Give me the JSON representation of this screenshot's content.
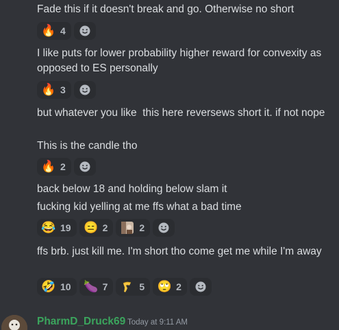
{
  "messages": [
    {
      "text": "Fade this if it doesn't break and go. Otherwise no short",
      "reactions": [
        {
          "emoji": "🔥",
          "emoji_name": "fire",
          "count": "4"
        }
      ]
    },
    {
      "text": "I like puts for lower probability higher reward for convexity as opposed to ES personally",
      "reactions": [
        {
          "emoji": "🔥",
          "emoji_name": "fire",
          "count": "3"
        }
      ]
    },
    {
      "text": "but whatever you like  this here reversews short it. if not nope"
    },
    {
      "text": "This is the candle tho",
      "reactions": [
        {
          "emoji": "🔥",
          "emoji_name": "fire",
          "count": "2"
        }
      ]
    },
    {
      "text": "back below 18 and holding below slam it"
    },
    {
      "text": "fucking kid yelling at me ffs what a bad time",
      "reactions": [
        {
          "emoji": "😂",
          "emoji_name": "joy",
          "count": "19"
        },
        {
          "emoji": "😑",
          "emoji_name": "expressionless",
          "count": "2"
        },
        {
          "emoji": "",
          "emoji_name": "custom-image-emoji",
          "count": "2"
        }
      ]
    },
    {
      "text": "ffs brb. just kill me. I'm short tho come get me while I'm away",
      "reactions": [
        {
          "emoji": "🤣",
          "emoji_name": "rofl",
          "count": "10"
        },
        {
          "emoji": "🍆",
          "emoji_name": "eggplant",
          "count": "7"
        },
        {
          "emoji": "",
          "emoji_name": "custom-yellow-emoji",
          "count": "5"
        },
        {
          "emoji": "🙄",
          "emoji_name": "rolling-eyes",
          "count": "2"
        }
      ]
    }
  ],
  "next_author": {
    "username": "PharmD_Druck69",
    "timestamp": "Today at 9:11 AM"
  },
  "colors": {
    "background": "#313338",
    "reaction_bg": "#2b2d31",
    "username": "#3ba55d",
    "text": "#dbdee1",
    "muted": "#949ba4"
  },
  "icons": {
    "add_reaction": "smile-plus-icon"
  }
}
